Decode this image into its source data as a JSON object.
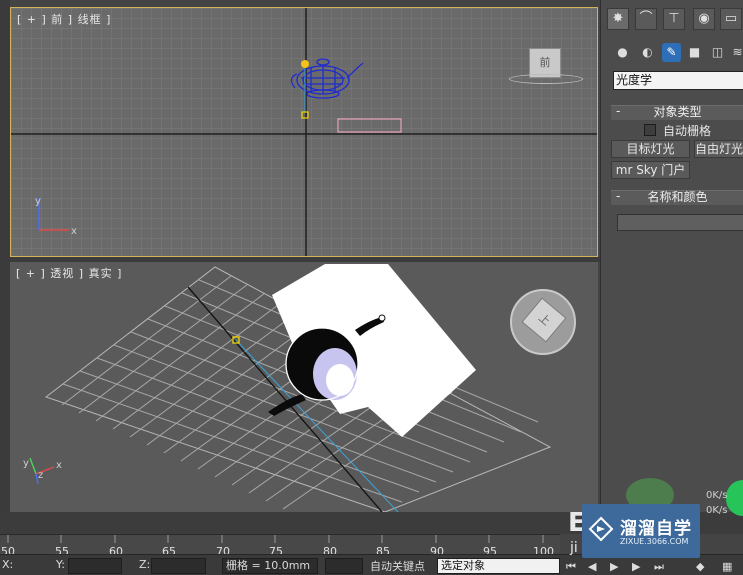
{
  "viewports": {
    "front": {
      "label": "[ + ] 前 ] 线框 ]"
    },
    "perspective": {
      "label": "[ + ] 透视 ] 真实 ]"
    },
    "viewcube_front": "前",
    "viewcube_persp": "上",
    "axis_labels": {
      "x": "x",
      "y": "y",
      "z": "z"
    }
  },
  "command_panel": {
    "tabs": [
      {
        "icon": "create-sun-icon",
        "glyph": "✸"
      },
      {
        "icon": "modify-curve-icon",
        "glyph": "⌒"
      },
      {
        "icon": "hierarchy-icon",
        "glyph": "⊤"
      },
      {
        "icon": "motion-icon",
        "glyph": "◉"
      },
      {
        "icon": "display-icon",
        "glyph": "▭"
      }
    ],
    "categories": [
      {
        "icon": "geometry-sphere-icon",
        "glyph": "●"
      },
      {
        "icon": "shapes-icon",
        "glyph": "◐"
      },
      {
        "icon": "lights-icon",
        "glyph": "✎"
      },
      {
        "icon": "camera-icon",
        "glyph": "■"
      },
      {
        "icon": "helpers-icon",
        "glyph": "◫"
      },
      {
        "icon": "space-warps-icon",
        "glyph": "≋"
      }
    ],
    "type_dropdown": "光度学",
    "object_type": {
      "title": "对象类型",
      "minus": "-",
      "autogrid_label": "自动栅格",
      "buttons": [
        "目标灯光",
        "自由灯光",
        "mr Sky 门户"
      ]
    },
    "name_color": {
      "title": "名称和颜色",
      "minus": "-"
    }
  },
  "timeline": {
    "ticks": [
      "50",
      "55",
      "60",
      "65",
      "70",
      "75",
      "80",
      "85",
      "90",
      "95",
      "100"
    ]
  },
  "status_bar": {
    "x_label": "X:",
    "y_label": "Y:",
    "z_label": "Z:",
    "grid_text": "栅格 = 10.0mm",
    "autokey_label": "自动关键点",
    "selected_object": "选定对象",
    "kb_top": "0K/s",
    "kb_bottom": "0K/s"
  },
  "watermark": {
    "title": "溜溜自学",
    "url": "ZIXUE.3066.COM",
    "ghost_e": "E",
    "ghost_ji": "ji"
  }
}
